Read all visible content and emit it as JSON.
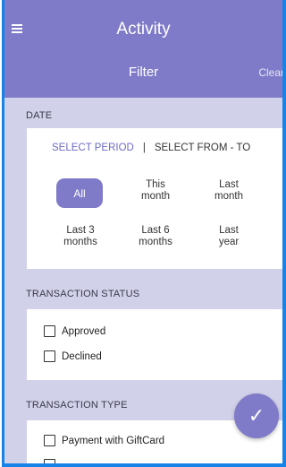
{
  "header": {
    "title": "Activity",
    "subtitle": "Filter",
    "clear_label": "Clear"
  },
  "date": {
    "label": "DATE",
    "tabs": [
      "SELECT PERIOD",
      "SELECT FROM - TO"
    ],
    "separator": "|",
    "options": [
      "All",
      "This month",
      "Last month",
      "Last 3 months",
      "Last 6 months",
      "Last year"
    ],
    "selected": "All"
  },
  "status": {
    "label": "TRANSACTION STATUS",
    "items": [
      "Approved",
      "Declined"
    ]
  },
  "type": {
    "label": "TRANSACTION TYPE",
    "items": [
      "Payment with GiftCard"
    ]
  },
  "fab": {
    "icon": "check-icon",
    "glyph": "✓"
  },
  "colors": {
    "accent": "#7f7bc8",
    "background": "#d2d1ea",
    "frame": "#1683e8"
  }
}
